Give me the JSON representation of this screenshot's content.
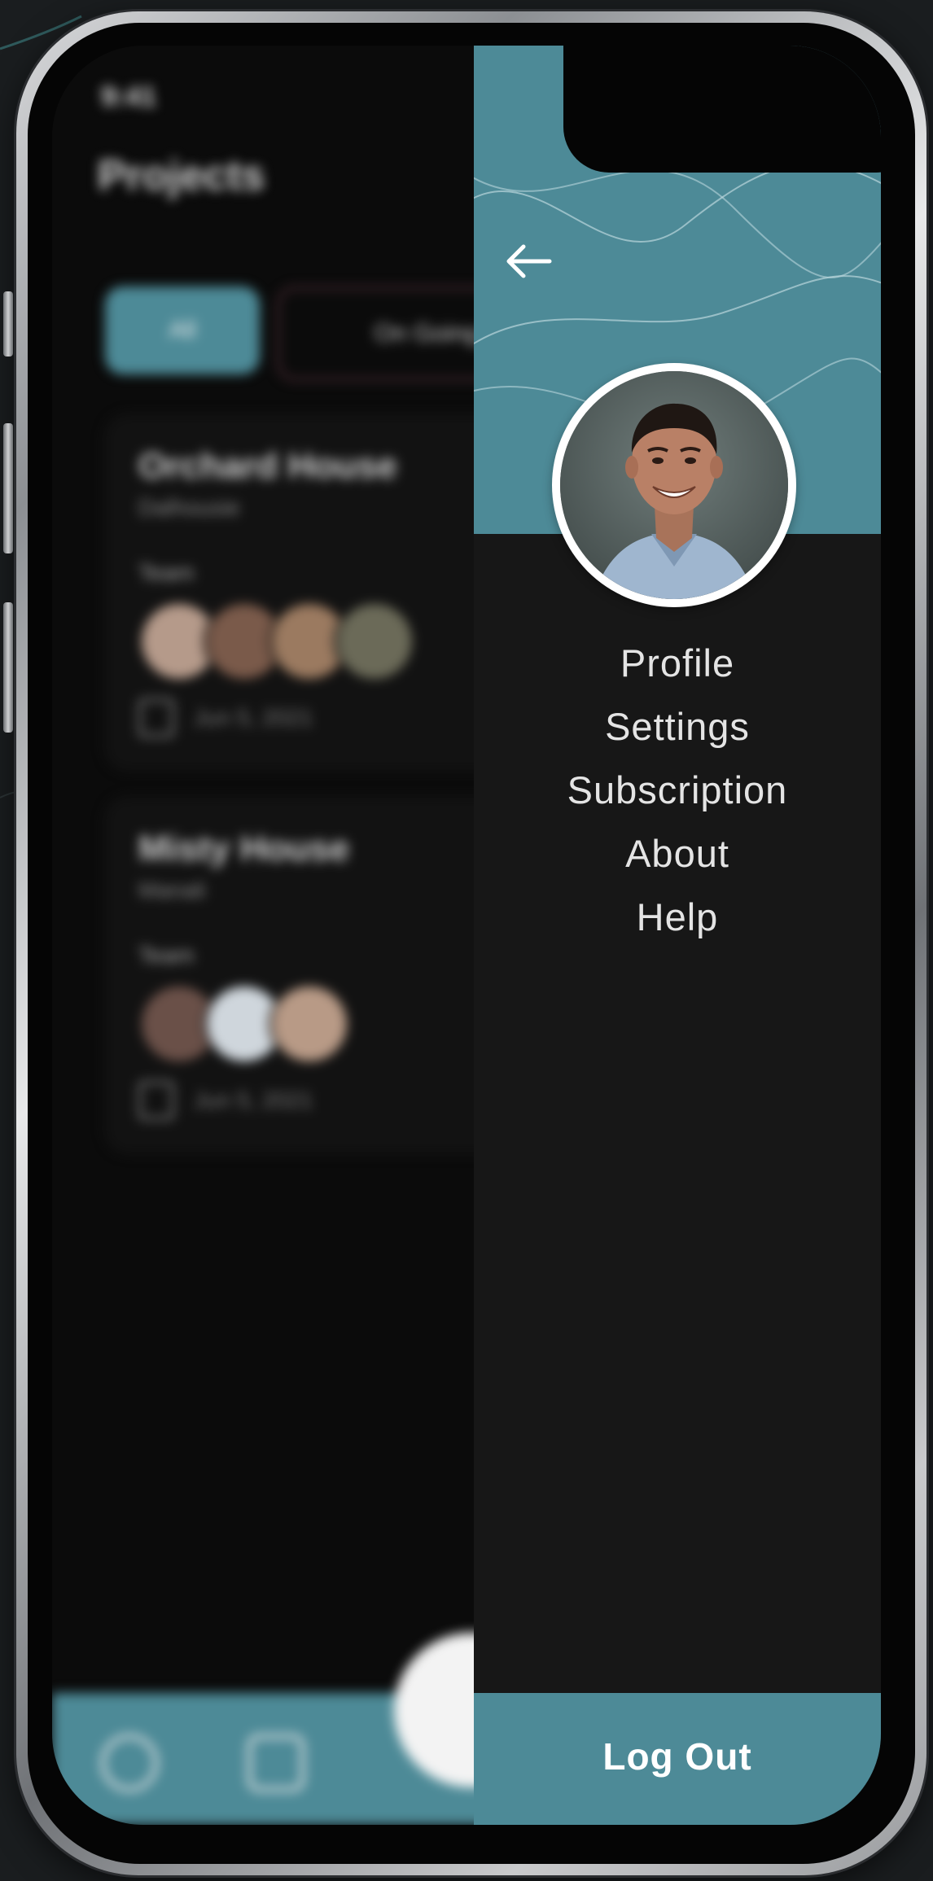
{
  "app": {
    "status_time": "9:41",
    "title": "Projects",
    "filters": [
      "All",
      "On Going"
    ],
    "projects": [
      {
        "name": "Orchard House",
        "subtitle": "Dalhousie",
        "team_label": "Team",
        "date": "Jun 5, 2021"
      },
      {
        "name": "Misty House",
        "subtitle": "Manali",
        "team_label": "Team",
        "date": "Jun 5, 2021"
      }
    ]
  },
  "drawer": {
    "back_icon": "arrow-left-icon",
    "avatar": "user-profile-photo",
    "menu": [
      {
        "label": "Profile"
      },
      {
        "label": "Settings"
      },
      {
        "label": "Subscription"
      },
      {
        "label": "About"
      },
      {
        "label": "Help"
      }
    ],
    "logout_label": "Log Out"
  },
  "colors": {
    "accent": "#4d8a97",
    "drawer_bg": "#171717",
    "text": "#e4e4e4"
  }
}
